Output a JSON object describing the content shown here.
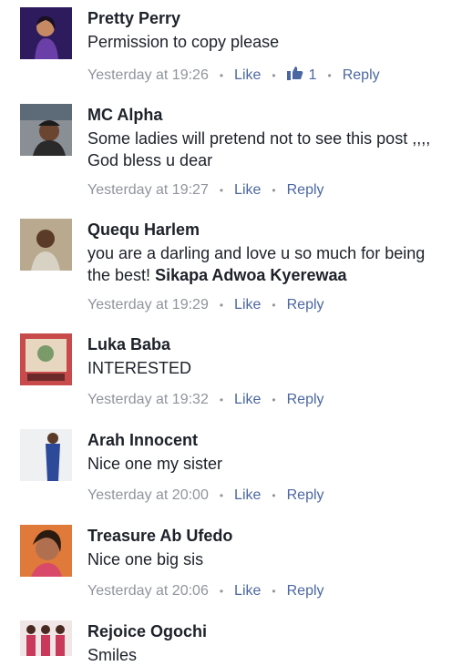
{
  "comments": [
    {
      "name": "Pretty Perry",
      "text": "Permission to copy please",
      "time": "Yesterday at 19:26",
      "like": "Like",
      "reactions": "1",
      "reply": "Reply"
    },
    {
      "name": "MC Alpha",
      "text": "Some ladies will pretend not to see this post ,,,, God bless u dear",
      "time": "Yesterday at 19:27",
      "like": "Like",
      "reply": "Reply"
    },
    {
      "name": "Quequ Harlem",
      "text": "you are a darling and love u so much for being the best!",
      "mention": "Sikapa Adwoa Kyerewaa",
      "time": "Yesterday at 19:29",
      "like": "Like",
      "reply": "Reply"
    },
    {
      "name": "Luka Baba",
      "text": "INTERESTED",
      "time": "Yesterday at 19:32",
      "like": "Like",
      "reply": "Reply"
    },
    {
      "name": "Arah Innocent",
      "text": "Nice one my sister",
      "time": "Yesterday at 20:00",
      "like": "Like",
      "reply": "Reply"
    },
    {
      "name": "Treasure Ab Ufedo",
      "text": "Nice one big sis",
      "time": "Yesterday at 20:06",
      "like": "Like",
      "reply": "Reply"
    },
    {
      "name": "Rejoice Ogochi",
      "text": "Smiles"
    }
  ],
  "separator": "•",
  "icons": {
    "like_reaction": "thumbs-up-icon"
  },
  "colors": {
    "name": "#1d2129",
    "meta": "#90949c",
    "link": "#4b67a1"
  }
}
